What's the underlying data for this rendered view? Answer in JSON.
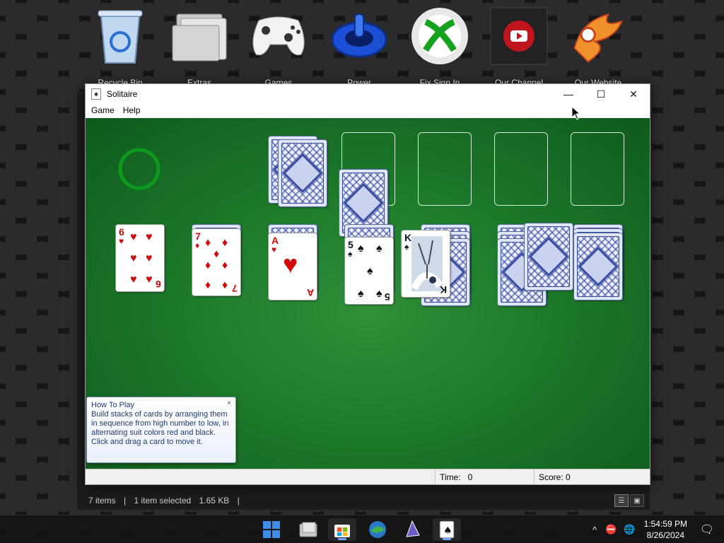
{
  "desktop": {
    "icons": [
      {
        "label": "Recycle Bin",
        "icon": "recycle-bin-icon"
      },
      {
        "label": "Extras",
        "icon": "folder-icon"
      },
      {
        "label": "Games",
        "icon": "gamepad-icon"
      },
      {
        "label": "Power",
        "icon": "power-icon"
      },
      {
        "label": "Fix Sign In",
        "icon": "xbox-icon"
      },
      {
        "label": "Our Channel",
        "icon": "youtube-icon"
      },
      {
        "label": "Our Website",
        "icon": "phoenix-icon"
      }
    ]
  },
  "explorer": {
    "status": {
      "items": "7 items",
      "selected": "1 item selected",
      "size": "1.65 KB"
    }
  },
  "solitaire": {
    "title": "Solitaire",
    "menu": [
      "Game",
      "Help"
    ],
    "statusbar": {
      "time_label": "Time:",
      "time_value": "0",
      "score_label": "Score:",
      "score_value": "0"
    },
    "tableau_faceup": [
      {
        "rank": "6",
        "suit": "♥",
        "color": "red"
      },
      {
        "rank": "7",
        "suit": "♦",
        "color": "red"
      },
      {
        "rank": "A",
        "suit": "♥",
        "color": "red"
      },
      {
        "rank": "5",
        "suit": "♠",
        "color": "black"
      },
      {
        "rank": "K",
        "suit": "♠",
        "color": "black"
      }
    ],
    "tooltip": {
      "title": "How To Play",
      "body": "Build stacks of cards by arranging them in sequence from high number to low, in alternating suit colors red and black. Click and drag a card to move it.",
      "close": "×"
    }
  },
  "taskbar": {
    "apps": [
      "windows-start-icon",
      "file-explorer-icon",
      "store-icon",
      "browser-icon",
      "media-icon",
      "solitaire-icon"
    ],
    "clock": {
      "time": "1:54:59 PM",
      "date": "8/26/2024"
    },
    "tray": {
      "chevron": "^"
    }
  },
  "colors": {
    "felt": "#1c7a2a",
    "card_red": "#d10a0a",
    "card_back": "#3a4fa0"
  }
}
